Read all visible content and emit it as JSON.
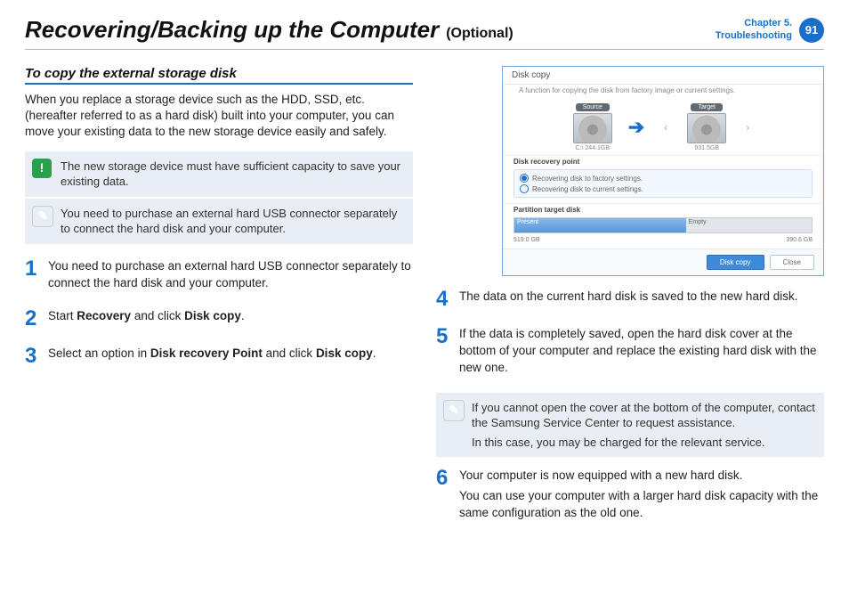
{
  "header": {
    "title": "Recovering/Backing up the Computer",
    "suffix": "(Optional)",
    "chapter_line1": "Chapter 5.",
    "chapter_line2": "Troubleshooting",
    "page_number": "91"
  },
  "section": {
    "heading": "To copy the external storage disk",
    "intro": "When you replace a storage device such as the HDD, SSD, etc. (hereafter referred to as a hard disk) built into your computer, you can move your existing data to the new storage device easily and safely."
  },
  "callouts": {
    "alert": "The new storage device must have sufficient capacity to save your existing data.",
    "note_usb": "You need to purchase an external hard USB connector separately to connect the hard disk and your computer.",
    "note_cover_l1": "If you cannot open the cover at the bottom of the computer, contact the Samsung Service Center to request assistance.",
    "note_cover_l2": "In this case, you may be charged for the relevant service."
  },
  "steps": {
    "s1": "You need to purchase an external hard USB connector separately to connect the hard disk and your computer.",
    "s2_a": "Start ",
    "s2_b": "Recovery",
    "s2_c": " and click ",
    "s2_d": "Disk copy",
    "s2_e": ".",
    "s3_a": "Select an option in ",
    "s3_b": "Disk recovery Point",
    "s3_c": " and click ",
    "s3_d": "Disk copy",
    "s3_e": ".",
    "s4": "The data on the current hard disk is saved to the new hard disk.",
    "s5": "If the data is completely saved, open the hard disk cover at the bottom of your computer and replace the existing hard disk with the new one.",
    "s6_a": "Your computer is now equipped with a new hard disk.",
    "s6_b": "You can use your computer with a larger hard disk capacity with the same configuration as the old one."
  },
  "shot": {
    "window_title": "Disk copy",
    "subtitle": "A function for copying the disk from factory image or current settings.",
    "source_label": "Source",
    "target_label": "Target",
    "source_cap": "C:\\ 244.1GB",
    "target_cap": "931.5GB",
    "drp_label": "Disk recovery point",
    "radio1": "Recovering disk to factory settings.",
    "radio2": "Recovering disk to current settings.",
    "ptd_label": "Partition target disk",
    "part_a": "Present",
    "part_b": "Empty",
    "cap_a": "519.0 GB",
    "cap_b": "390.6 GB",
    "btn_primary": "Disk copy",
    "btn_close": "Close"
  }
}
